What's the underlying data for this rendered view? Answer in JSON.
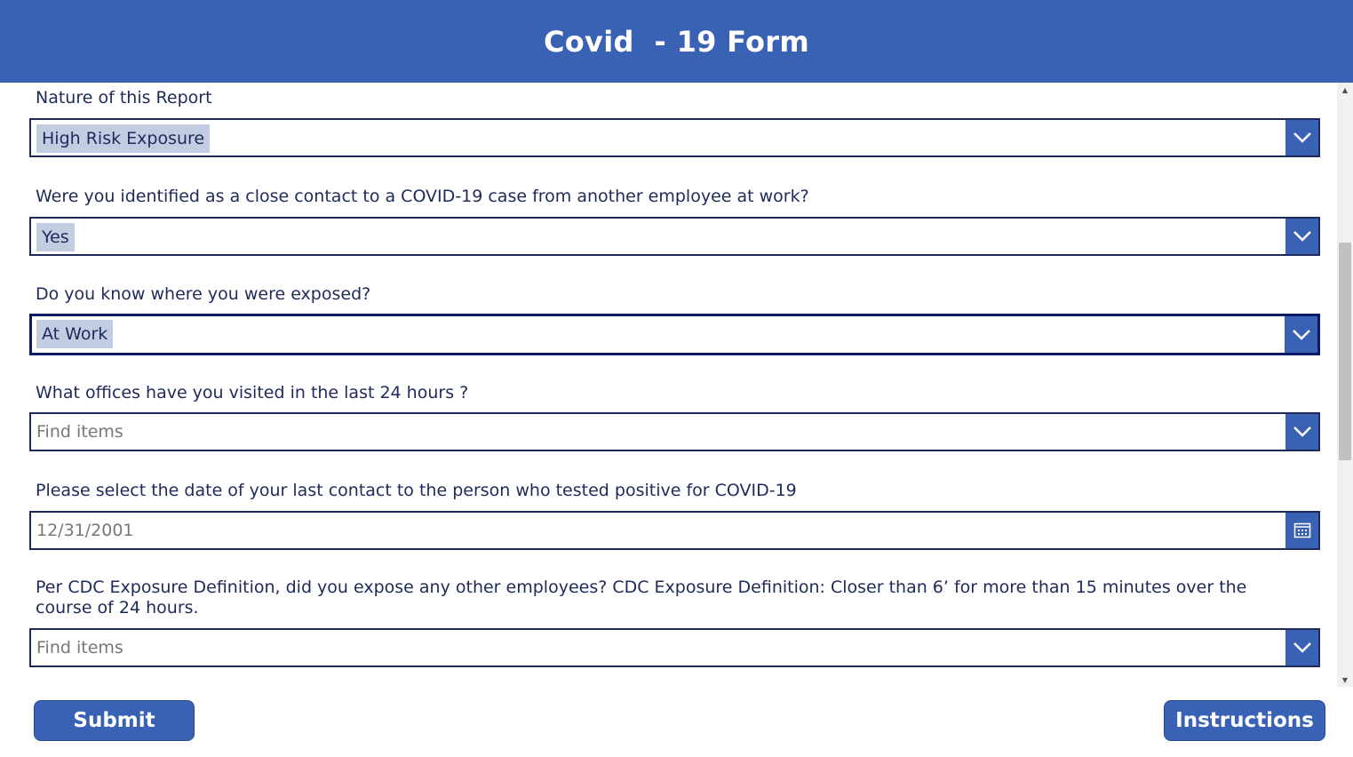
{
  "app": {
    "title": "Covid  - 19 Form"
  },
  "colors": {
    "header": "#3A62B4",
    "accent": "#3A62B4",
    "text": "#1e2a5a",
    "chip": "#c3cde2"
  },
  "fields": [
    {
      "label": "Nature of this Report",
      "type": "dropdown",
      "value": "High Risk Exposure",
      "icon": "chevron-down-icon"
    },
    {
      "label": "Were you identified as a close contact to a COVID-19 case from another employee at work?",
      "type": "dropdown",
      "value": "Yes",
      "icon": "chevron-down-icon"
    },
    {
      "label": "Do you know where you were exposed?",
      "type": "dropdown",
      "value": "At Work",
      "focused": true,
      "icon": "chevron-down-icon"
    },
    {
      "label": "What offices have you visited in the last 24 hours ?",
      "type": "combobox",
      "placeholder": "Find items",
      "icon": "chevron-down-icon"
    },
    {
      "label": "Please select the date of your last contact to the person who tested positive for COVID-19",
      "type": "date",
      "placeholder": "12/31/2001",
      "icon": "calendar-icon"
    },
    {
      "label": "Per CDC Exposure Definition, did you expose any other employees? CDC Exposure Definition: Closer than 6’ for more than 15 minutes over the course of 24 hours.",
      "type": "combobox",
      "placeholder": "Find items",
      "icon": "chevron-down-icon"
    }
  ],
  "buttons": {
    "submit": "Submit",
    "instructions": "Instructions"
  }
}
